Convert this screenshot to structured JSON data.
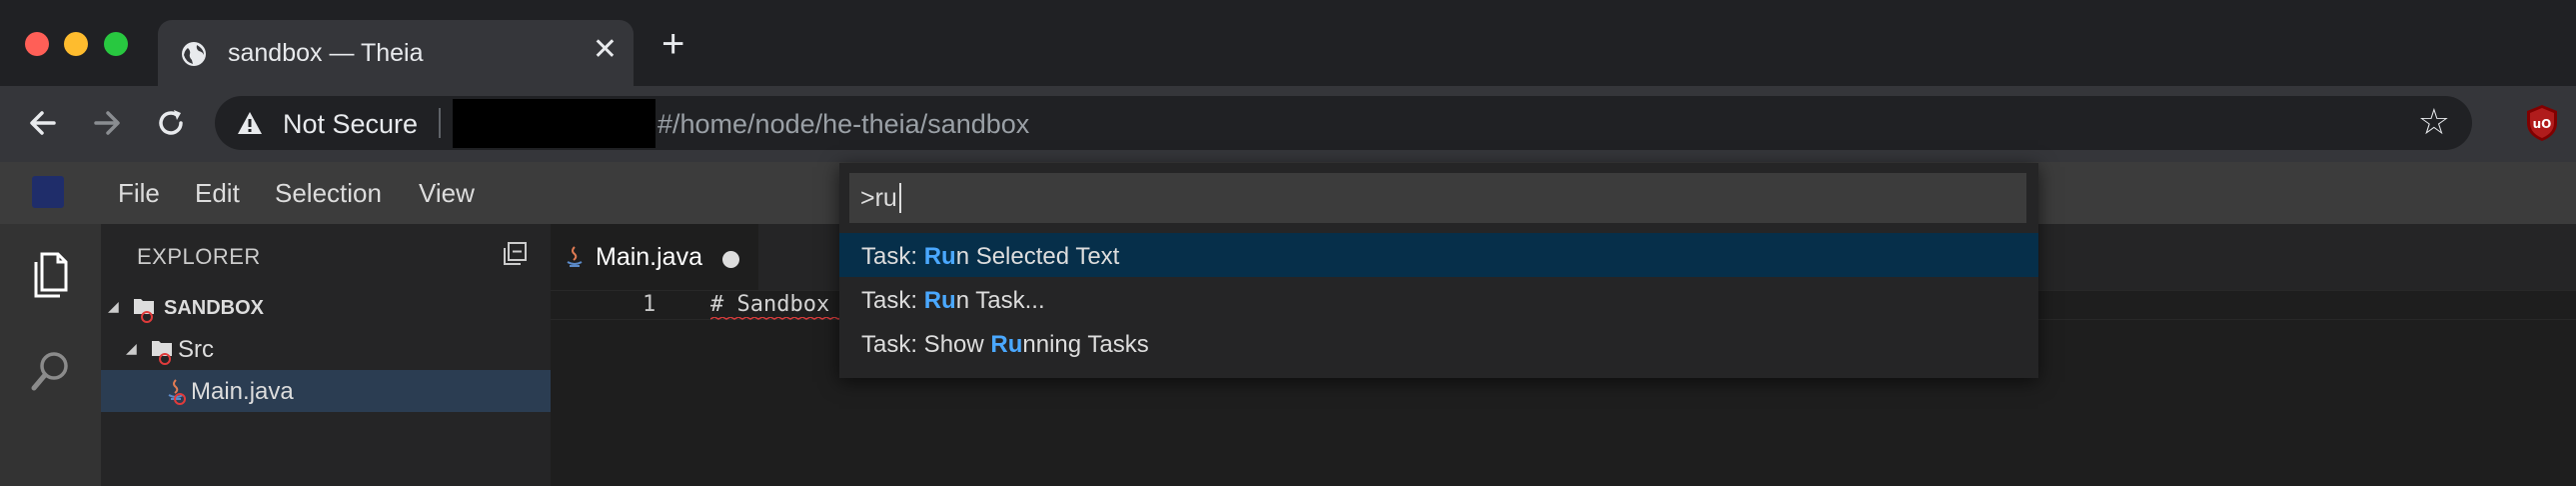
{
  "browser": {
    "tab_title": "sandbox — Theia",
    "tab_close": "✕",
    "new_tab": "+",
    "security_label": "Not Secure",
    "url_path": "#/home/node/he-theia/sandbox",
    "star_glyph": "☆"
  },
  "menu": {
    "items": [
      "File",
      "Edit",
      "Selection",
      "View"
    ]
  },
  "explorer": {
    "title": "EXPLORER",
    "tree": [
      {
        "label": "SANDBOX",
        "kind": "folder",
        "expanded": true
      },
      {
        "label": "Src",
        "kind": "folder",
        "expanded": true
      },
      {
        "label": "Main.java",
        "kind": "java-file",
        "selected": true
      }
    ]
  },
  "editor": {
    "tab_label": "Main.java",
    "tab_dirty": true,
    "line_number": "1",
    "line_text": "# Sandbox"
  },
  "quick_open": {
    "value": ">ru",
    "items": [
      {
        "prefix": "Task: ",
        "match": "Ru",
        "rest": "n Selected Text",
        "active": true
      },
      {
        "prefix": "Task: ",
        "match": "Ru",
        "rest": "n Task...",
        "active": false
      },
      {
        "prefix": "Task: Show ",
        "match": "Ru",
        "rest": "nning Tasks",
        "active": false
      }
    ]
  },
  "colors": {
    "accent": "#4aa8ff",
    "active_row": "#062f4a",
    "error_badge": "#e03b3b"
  }
}
